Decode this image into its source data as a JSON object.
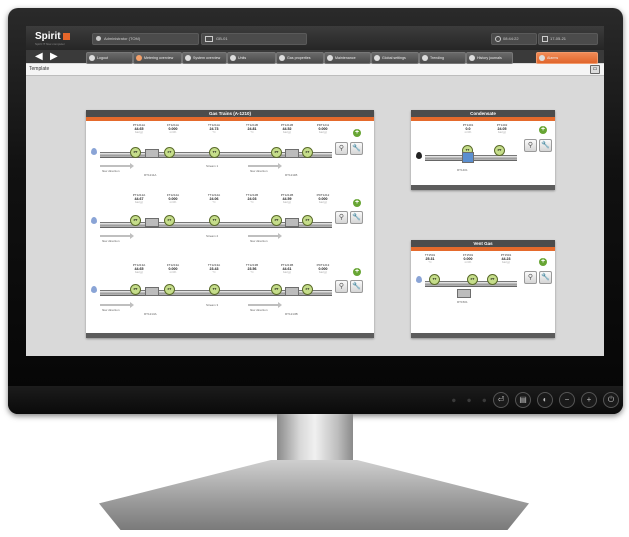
{
  "app": {
    "logo": "Spirit",
    "logo_sub": "Spirit IT flow computer",
    "user": "Administrator (TOM)",
    "status": "GB-01",
    "time": "08:44:22",
    "date": "17-05-21"
  },
  "nav": {
    "back": "◀",
    "forward": "▶",
    "tabs": [
      {
        "label": "Logout",
        "active": false
      },
      {
        "label": "Metering overview",
        "active": false
      },
      {
        "label": "System overview",
        "active": false
      },
      {
        "label": "Units",
        "active": false
      },
      {
        "label": "Gas properties",
        "active": false
      },
      {
        "label": "Maintenance",
        "active": false
      },
      {
        "label": "Global settings",
        "active": false
      },
      {
        "label": "Trending",
        "active": false
      },
      {
        "label": "History journals",
        "active": false
      },
      {
        "label": "Alarms",
        "active": true
      }
    ]
  },
  "page": {
    "title": "Template"
  },
  "gas_trains": {
    "title": "Gas Trains (A-1210)",
    "rows": [
      {
        "readings": [
          {
            "tag": "PT1211A",
            "value": "44.65",
            "unit": "bar(g)"
          },
          {
            "tag": "FT1211A",
            "value": "0.000",
            "unit": "m3/h"
          },
          {
            "tag": "TT1211A",
            "value": "24.73",
            "unit": "°C"
          },
          {
            "tag": "TT1211B",
            "value": "24.81",
            "unit": "°C"
          },
          {
            "tag": "PT1211B",
            "value": "44.52",
            "unit": "bar(g)"
          },
          {
            "tag": "PDT1211",
            "value": "0.000",
            "unit": "bar(g)"
          }
        ],
        "stream": "Stream 1",
        "tag_left": "RT1211A",
        "tag_right": "RT1211B"
      },
      {
        "readings": [
          {
            "tag": "PT1212A",
            "value": "44.67",
            "unit": "bar(g)"
          },
          {
            "tag": "FT1212A",
            "value": "0.000",
            "unit": "m3/h"
          },
          {
            "tag": "TT1212A",
            "value": "24.06",
            "unit": "°C"
          },
          {
            "tag": "TT1212B",
            "value": "24.03",
            "unit": "°C"
          },
          {
            "tag": "PT1212B",
            "value": "44.59",
            "unit": "bar(g)"
          },
          {
            "tag": "PDT1212",
            "value": "0.000",
            "unit": "bar(g)"
          }
        ],
        "stream": "Stream 2",
        "tag_left": "",
        "tag_right": ""
      },
      {
        "readings": [
          {
            "tag": "PT1213A",
            "value": "44.65",
            "unit": "bar(g)"
          },
          {
            "tag": "FT1213A",
            "value": "0.000",
            "unit": "m3/h"
          },
          {
            "tag": "TT1213A",
            "value": "23.43",
            "unit": "°C"
          },
          {
            "tag": "TT1213B",
            "value": "23.56",
            "unit": "°C"
          },
          {
            "tag": "PT1213B",
            "value": "44.61",
            "unit": "bar(g)"
          },
          {
            "tag": "PDT1213",
            "value": "0.000",
            "unit": "bar(g)"
          }
        ],
        "stream": "Stream 3",
        "tag_left": "RT1213A",
        "tag_right": "RT1213B"
      }
    ],
    "flow_dir_label": "flow direction"
  },
  "condensate": {
    "title": "Condensate",
    "readings": [
      {
        "tag": "PT1401",
        "value": "0.0",
        "unit": "m3/h"
      },
      {
        "tag": "PT1402",
        "value": "24.05",
        "unit": "bar(g)"
      }
    ],
    "tag": "RT1401"
  },
  "vent_gas": {
    "title": "Vent Gas",
    "readings": [
      {
        "tag": "TT1501",
        "value": "25.31",
        "unit": "°C"
      },
      {
        "tag": "FT1501",
        "value": "0.000",
        "unit": "m3/h"
      },
      {
        "tag": "PT1501",
        "value": "44.23",
        "unit": "bar(g)"
      }
    ],
    "tag": "RT1501"
  },
  "instruments": {
    "pt": "PT",
    "ft": "FT",
    "tt": "TT"
  },
  "icons": {
    "zoom": "⚲",
    "wrench": "🔧",
    "plus": "+"
  },
  "monitor": {
    "dots": "● ● ● ●"
  },
  "colors": {
    "accent": "#e56a2c",
    "panel_header": "#4c4c4c",
    "instrument": "#c5dd8a"
  }
}
